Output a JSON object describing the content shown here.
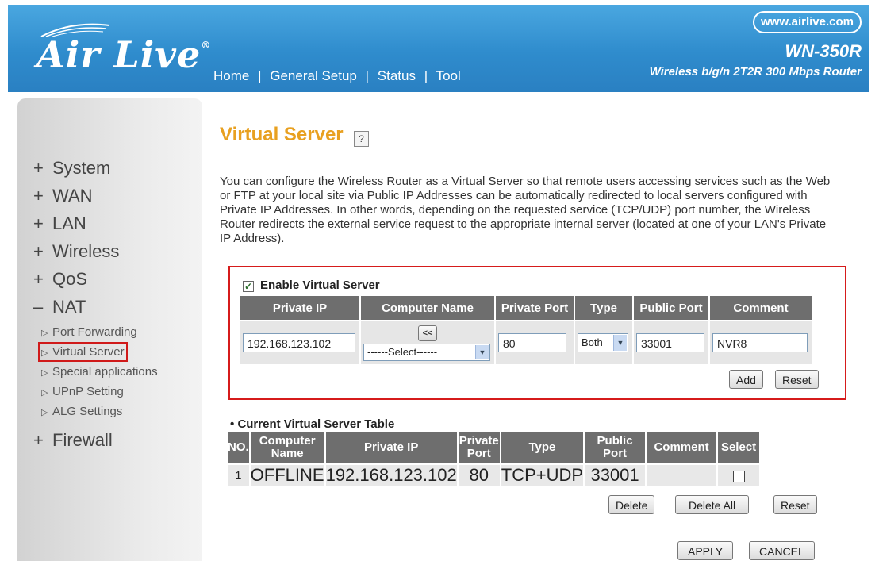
{
  "header": {
    "logo_text": "Air Live",
    "logo_mark": "®",
    "nav": [
      "Home",
      "General Setup",
      "Status",
      "Tool"
    ],
    "nav_separator": "|",
    "url": "www.airlive.com",
    "model": "WN-350R",
    "model_desc": "Wireless b/g/n 2T2R 300 Mbps Router"
  },
  "sidebar": {
    "items": [
      {
        "sym": "+",
        "label": "System"
      },
      {
        "sym": "+",
        "label": "WAN"
      },
      {
        "sym": "+",
        "label": "LAN"
      },
      {
        "sym": "+",
        "label": "Wireless"
      },
      {
        "sym": "+",
        "label": "QoS"
      },
      {
        "sym": "–",
        "label": "NAT"
      }
    ],
    "nat_sub": [
      "Port Forwarding",
      "Virtual Server",
      "Special applications",
      "UPnP Setting",
      "ALG Settings"
    ],
    "active_sub": "Virtual Server",
    "after": {
      "sym": "+",
      "label": "Firewall"
    }
  },
  "main": {
    "title": "Virtual Server",
    "help_icon_glyph": "?",
    "description": "You can configure the Wireless Router as a Virtual Server so that remote users accessing services such as the Web or FTP at your local site via Public IP Addresses can be automatically redirected to local servers configured with Private IP Addresses. In other words, depending on the requested service (TCP/UDP) port number, the Wireless Router redirects the external service request to the appropriate internal server (located at one of your LAN's Private IP Address).",
    "enable_label": "Enable Virtual Server",
    "enable_checked": true,
    "form_headers": [
      "Private IP",
      "Computer Name",
      "Private Port",
      "Type",
      "Public Port",
      "Comment"
    ],
    "form": {
      "private_ip": "192.168.123.102",
      "copy_btn": "<<",
      "computer_name_select": "------Select------",
      "private_port": "80",
      "type": "Both",
      "public_port": "33001",
      "comment": "NVR8"
    },
    "add_btn": "Add",
    "reset_btn": "Reset",
    "current_title": "Current Virtual Server Table",
    "current_bullet": "•",
    "current_headers": {
      "no": "NO.",
      "computer_name": "Computer Name",
      "private_ip": "Private IP",
      "private_port": "Private Port",
      "type": "Type",
      "public_port": "Public Port",
      "comment": "Comment",
      "select": "Select"
    },
    "rows": [
      {
        "no": "1",
        "computer_name": "OFFLINE",
        "private_ip": "192.168.123.102",
        "private_port": "80",
        "type": "TCP+UDP",
        "public_port": "33001",
        "comment": ""
      }
    ],
    "delete_btn": "Delete",
    "delete_all_btn": "Delete All",
    "reset2_btn": "Reset",
    "apply_btn": "APPLY",
    "cancel_btn": "CANCEL"
  }
}
